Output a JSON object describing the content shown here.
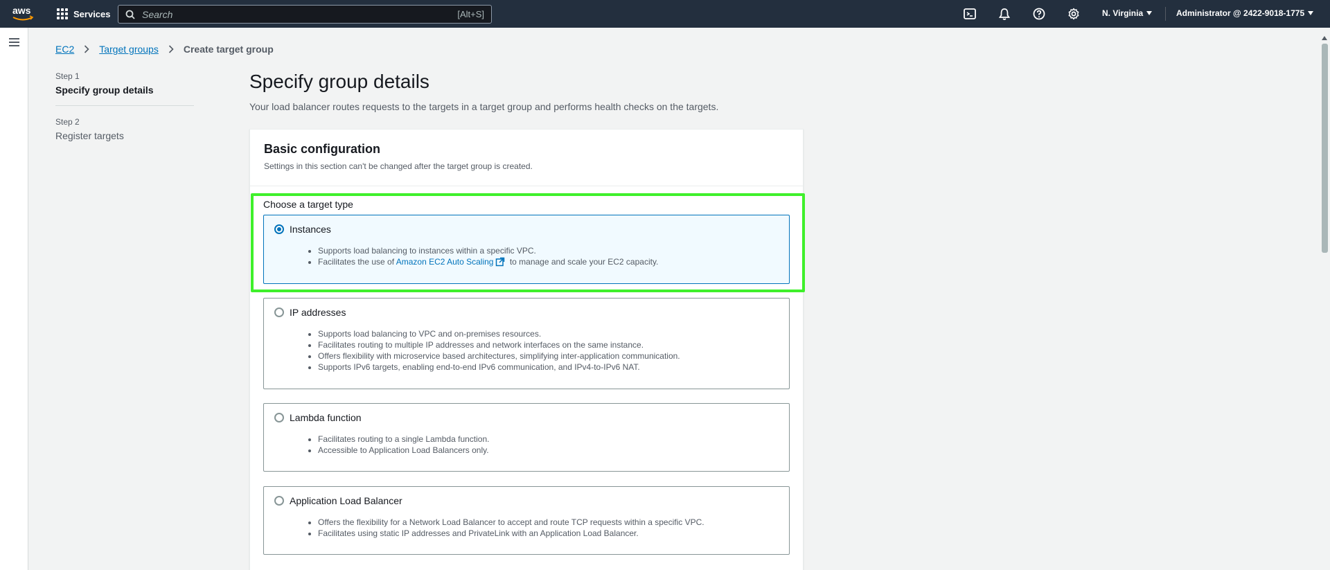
{
  "topnav": {
    "logo_text": "aws",
    "services_label": "Services",
    "search_placeholder": "Search",
    "search_shortcut": "[Alt+S]",
    "region": "N. Virginia",
    "account": "Administrator @ 2422-9018-1775",
    "icons": [
      "cloudshell-icon",
      "notifications-bell-icon",
      "help-icon",
      "settings-gear-icon"
    ]
  },
  "breadcrumb": {
    "items": [
      "EC2",
      "Target groups",
      "Create target group"
    ]
  },
  "steps": [
    {
      "num": "Step 1",
      "label": "Specify group details",
      "current": true
    },
    {
      "num": "Step 2",
      "label": "Register targets",
      "current": false
    }
  ],
  "page": {
    "title": "Specify group details",
    "description": "Your load balancer routes requests to the targets in a target group and performs health checks on the targets."
  },
  "basic_config": {
    "title": "Basic configuration",
    "subtitle": "Settings in this section can't be changed after the target group is created.",
    "choose_label": "Choose a target type",
    "options": [
      {
        "label": "Instances",
        "selected": true,
        "bullets": [
          "Supports load balancing to instances within a specific VPC."
        ],
        "bullet2_prefix": "Facilitates the use of ",
        "bullet2_link": "Amazon EC2 Auto Scaling",
        "bullet2_suffix": " to manage and scale your EC2 capacity."
      },
      {
        "label": "IP addresses",
        "selected": false,
        "bullets": [
          "Supports load balancing to VPC and on-premises resources.",
          "Facilitates routing to multiple IP addresses and network interfaces on the same instance.",
          "Offers flexibility with microservice based architectures, simplifying inter-application communication.",
          "Supports IPv6 targets, enabling end-to-end IPv6 communication, and IPv4-to-IPv6 NAT."
        ]
      },
      {
        "label": "Lambda function",
        "selected": false,
        "bullets": [
          "Facilitates routing to a single Lambda function.",
          "Accessible to Application Load Balancers only."
        ]
      },
      {
        "label": "Application Load Balancer",
        "selected": false,
        "bullets": [
          "Offers the flexibility for a Network Load Balancer to accept and route TCP requests within a specific VPC.",
          "Facilitates using static IP addresses and PrivateLink with an Application Load Balancer."
        ]
      }
    ]
  },
  "colors": {
    "nav_bg": "#232f3e",
    "link": "#0073bb",
    "highlight": "#3ff02b",
    "selected_tile_bg": "#f1faff"
  }
}
